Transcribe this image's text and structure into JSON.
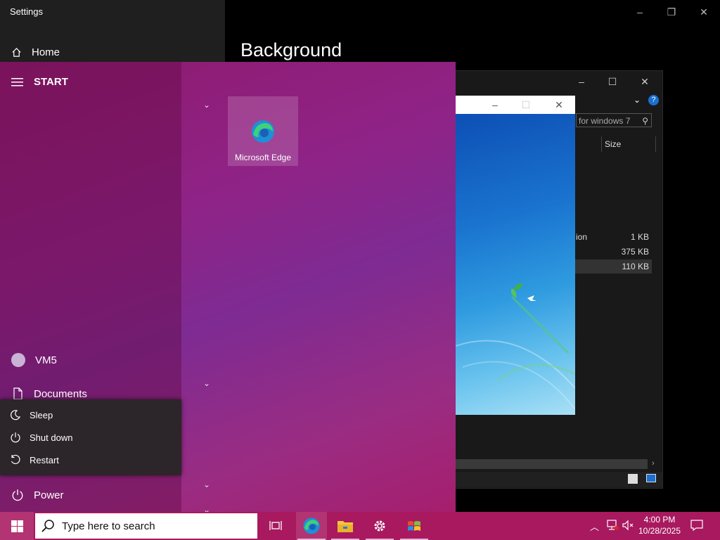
{
  "settings": {
    "title": "Settings",
    "home_label": "Home",
    "page_heading": "Background"
  },
  "explorer": {
    "search_placeholder": "for windows 7",
    "size_column": "Size",
    "rows": [
      {
        "name": "ion",
        "size": "1 KB"
      },
      {
        "name": "",
        "size": "375 KB"
      },
      {
        "name": "",
        "size": "110 KB"
      }
    ]
  },
  "start_menu": {
    "header": "START",
    "edge_tile_label": "Microsoft Edge",
    "user_label": "VM5",
    "documents_label": "Documents",
    "power_label": "Power",
    "power_options": [
      "Sleep",
      "Shut down",
      "Restart"
    ]
  },
  "taskbar": {
    "search_placeholder": "Type here to search",
    "time": "4:00 PM",
    "date": "10/28/2025",
    "apps": [
      "task-view",
      "microsoft-edge",
      "file-explorer",
      "settings",
      "windows-7-app"
    ]
  },
  "colors": {
    "start_accent": "#8f2387",
    "taskbar": "#a8195f"
  }
}
